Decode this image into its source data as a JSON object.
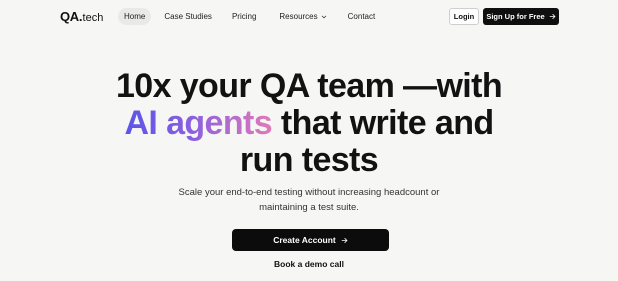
{
  "nav": {
    "logo": {
      "main": "QA",
      "dot": ".",
      "suffix": "tech"
    },
    "links": [
      {
        "label": "Home",
        "active": true
      },
      {
        "label": "Case Studies",
        "active": false
      },
      {
        "label": "Pricing",
        "active": false
      },
      {
        "label": "Resources",
        "active": false,
        "has_dropdown": true
      },
      {
        "label": "Contact",
        "active": false
      }
    ],
    "login_label": "Login",
    "signup_label": "Sign Up for Free"
  },
  "hero": {
    "title_line1": "10x your QA team —with",
    "title_highlight": "AI agents",
    "title_line2_rest": " that write and",
    "title_line3": "run tests",
    "subtitle_line1": "Scale your end-to-end testing without increasing headcount or",
    "subtitle_line2": "maintaining a test suite.",
    "cta_label": "Create Account",
    "demo_label": "Book a demo call"
  },
  "colors": {
    "background": "#f6f6f5",
    "button_dark": "#0c0c0c",
    "gradient_start": "#5b55e6",
    "gradient_end": "#e07ab8"
  },
  "icons": [
    "chevron-down-icon",
    "arrow-right-icon"
  ]
}
